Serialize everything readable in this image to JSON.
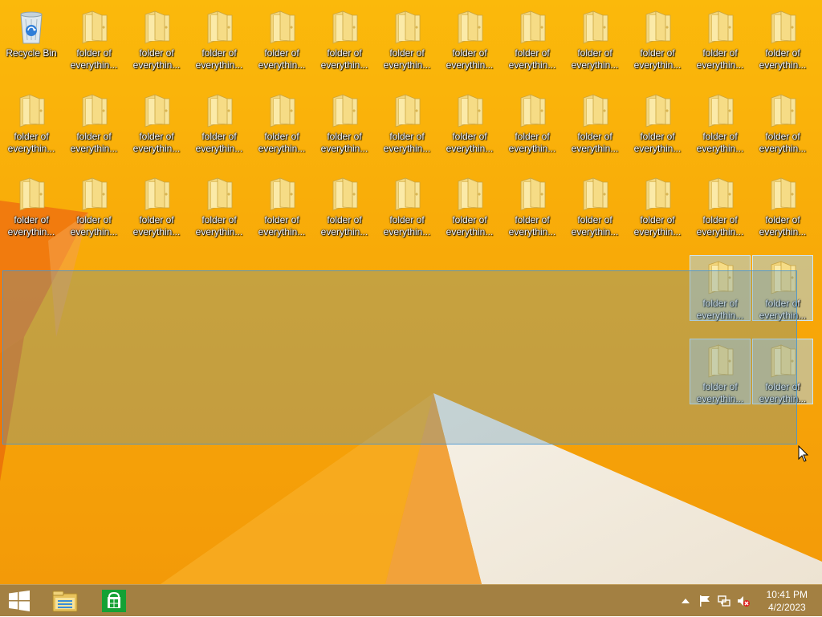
{
  "desktop": {
    "wallpaper_colors": {
      "base": "#f9b208",
      "accent": "#f08010",
      "light": "#f2ede4"
    },
    "recycle_bin_label": "Recycle Bin",
    "folder_label": "folder of everythin...",
    "folder_label_line1": "folder of",
    "folder_label_line2": "everythin...",
    "rows": [
      {
        "label_count": 13,
        "first_is_recycle_bin": true
      },
      {
        "label_count": 13,
        "first_is_recycle_bin": false
      },
      {
        "label_count": 13,
        "first_is_recycle_bin": false
      }
    ],
    "selected_folders_count": 4
  },
  "taskbar": {
    "start_icon": "windows-logo-icon",
    "pinned": [
      {
        "name": "file-explorer",
        "icon": "file-explorer-icon"
      },
      {
        "name": "store",
        "icon": "store-icon"
      }
    ],
    "tray_icons": [
      "show-hidden-icons-chevron-icon",
      "action-center-flag-icon",
      "network-icon",
      "volume-muted-icon"
    ],
    "clock": {
      "time": "10:41 PM",
      "date": "4/2/2023"
    }
  }
}
